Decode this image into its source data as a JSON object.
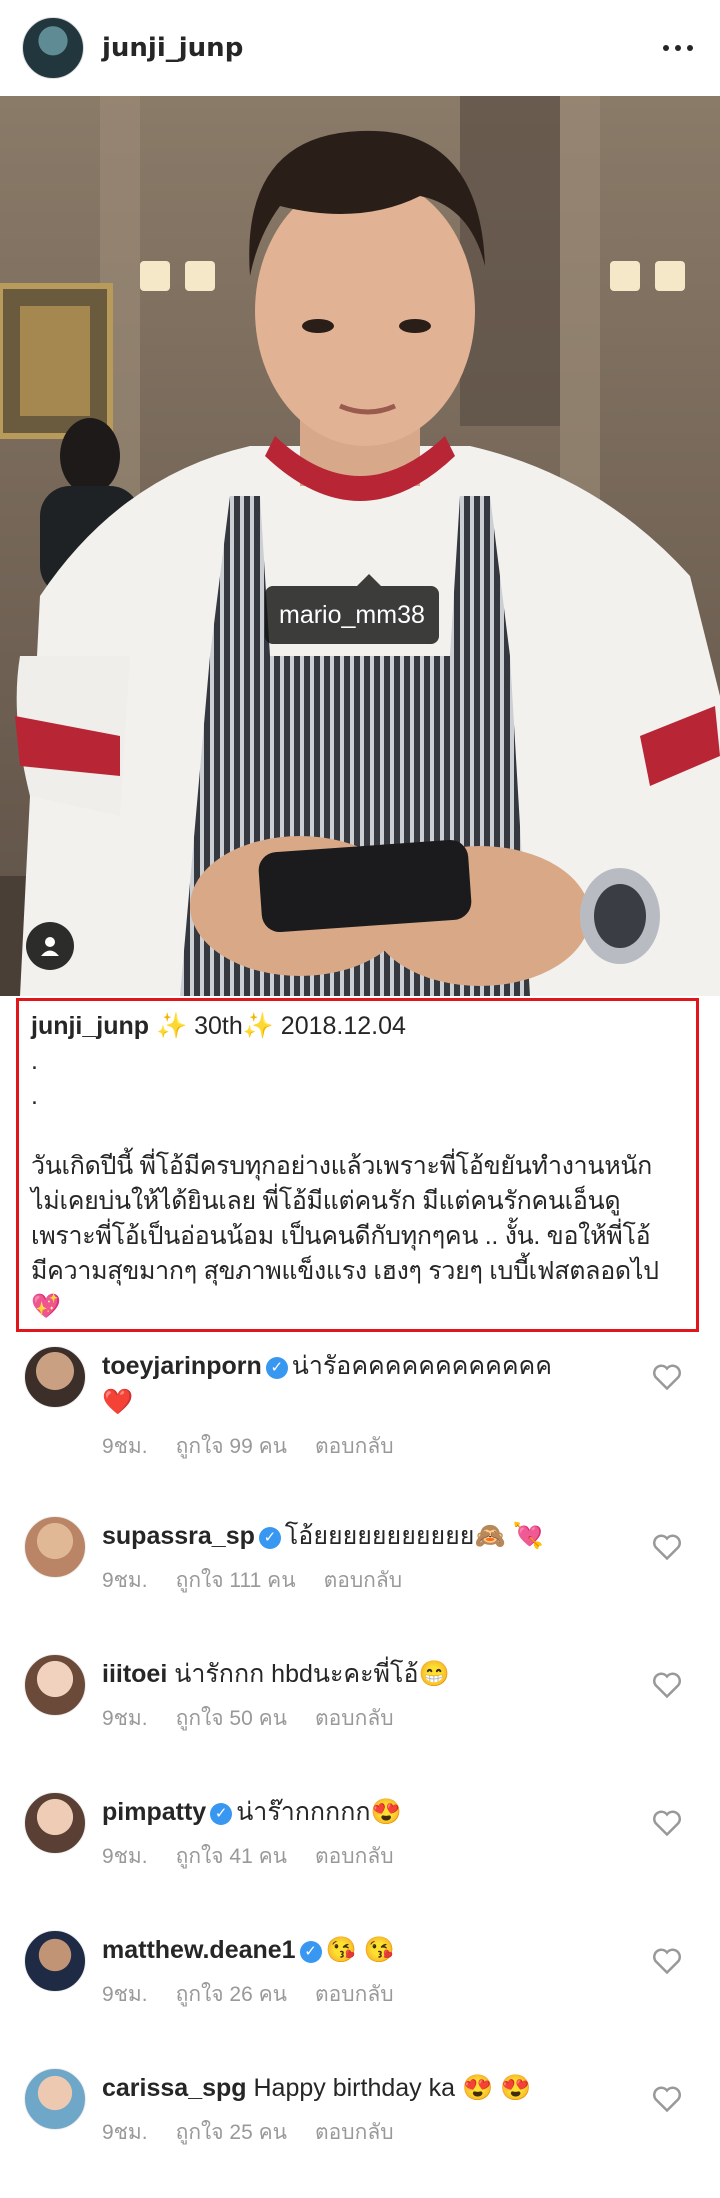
{
  "header": {
    "username": "junji_junp",
    "more_icon": "more-horizontal-icon"
  },
  "photo": {
    "tag_label": "mario_mm38",
    "tag_icon": "person-icon"
  },
  "caption": {
    "username": "junji_junp",
    "headline": " ✨ 30th✨  2018.12.04",
    "dots": ".\n.",
    "text": "วันเกิดปีนี้ พี่โอ้มีครบทุกอย่างแล้วเพราะพี่โอ้ขยันทำงานหนัก\nไม่เคยบ่นให้ได้ยินเลย พี่โอ้มีแต่คนรัก มีแต่คนรักคนเอ็นดู\nเพราะพี่โอ้เป็นอ่อนน้อม เป็นคนดีกับทุกๆคน .. งั้น. ขอให้พี่โอ้\nมีความสุขมากๆ สุขภาพแข็งแรง เฮงๆ รวยๆ เบบี้เฟสตลอดไป",
    "end_emoji": "💖"
  },
  "comments": [
    {
      "user": "toeyjarinporn",
      "verified": true,
      "text": "น่ารัอคคคคคคคคคคคค",
      "text2": "❤️",
      "time": "9ชม.",
      "likes": "ถูกใจ 99 คน",
      "reply": "ตอบกลับ"
    },
    {
      "user": "supassra_sp",
      "verified": true,
      "text": "โอ้ยยยยยยยยยยย🙈 💘",
      "text2": "",
      "time": "9ชม.",
      "likes": "ถูกใจ 111 คน",
      "reply": "ตอบกลับ"
    },
    {
      "user": "iiitoei",
      "verified": false,
      "text": "น่ารักกก hbdนะคะพี่โอ้😁",
      "text2": "",
      "time": "9ชม.",
      "likes": "ถูกใจ 50 คน",
      "reply": "ตอบกลับ"
    },
    {
      "user": "pimpatty",
      "verified": true,
      "text": "น่าร๊ากกกกก😍",
      "text2": "",
      "time": "9ชม.",
      "likes": "ถูกใจ 41 คน",
      "reply": "ตอบกลับ"
    },
    {
      "user": "matthew.deane1",
      "verified": true,
      "text": "😘 😘",
      "text2": "",
      "time": "9ชม.",
      "likes": "ถูกใจ 26 คน",
      "reply": "ตอบกลับ"
    },
    {
      "user": "carissa_spg",
      "verified": false,
      "text": "Happy birthday ka 😍 😍",
      "text2": "",
      "time": "9ชม.",
      "likes": "ถูกใจ 25 คน",
      "reply": "ตอบกลับ"
    }
  ],
  "colors": {
    "highlight_border": "#e0161b",
    "verified_blue": "#3897f0",
    "meta_gray": "#999999"
  }
}
